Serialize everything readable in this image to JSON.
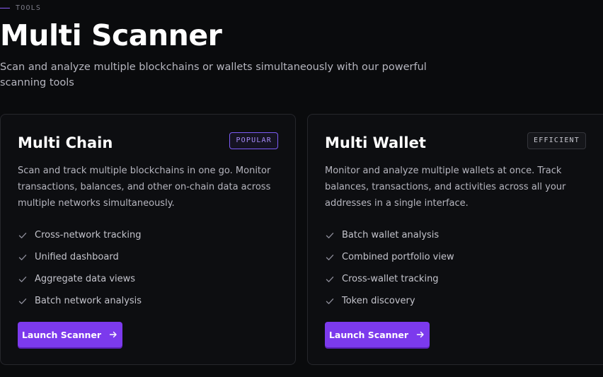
{
  "header": {
    "eyebrow": "TOOLS",
    "title": "Multi Scanner",
    "subtitle": "Scan and analyze multiple blockchains or wallets simultaneously with our powerful scanning tools"
  },
  "cards": [
    {
      "title": "Multi Chain",
      "badge": "POPULAR",
      "description": "Scan and track multiple blockchains in one go. Monitor transactions, balances, and other on-chain data across multiple networks simultaneously.",
      "features": [
        "Cross-network tracking",
        "Unified dashboard",
        "Aggregate data views",
        "Batch network analysis"
      ],
      "button_label": "Launch Scanner"
    },
    {
      "title": "Multi Wallet",
      "badge": "EFFICIENT",
      "description": "Monitor and analyze multiple wallets at once. Track balances, transactions, and activities across all your addresses in a single interface.",
      "features": [
        "Batch wallet analysis",
        "Combined portfolio view",
        "Cross-wallet tracking",
        "Token discovery"
      ],
      "button_label": "Launch Scanner"
    }
  ],
  "icons": {
    "feature": "check-icon",
    "button": "arrow-right-icon"
  },
  "colors": {
    "accent": "#7c3aed",
    "badge_popular": "#a78bfa",
    "background": "#0a0b0d"
  }
}
